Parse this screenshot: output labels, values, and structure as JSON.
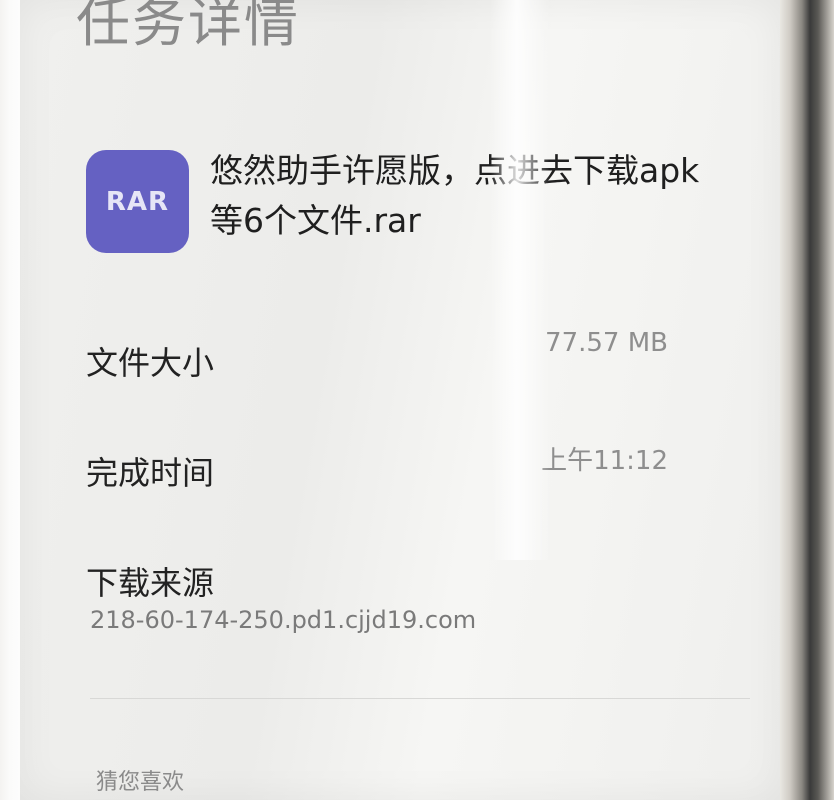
{
  "page": {
    "title": "任务详情"
  },
  "file": {
    "icon_label": "RAR",
    "icon_color": "#6561c2",
    "name": "悠然助手许愿版，点进去下载apk等6个文件.rar"
  },
  "details": {
    "size_label": "文件大小",
    "size_value": "77.57 MB",
    "time_label": "完成时间",
    "time_value": "上午11:12",
    "source_label": "下载来源",
    "source_value": "218-60-174-250.pd1.cjjd19.com"
  },
  "recommend": {
    "label": "猜您喜欢"
  }
}
